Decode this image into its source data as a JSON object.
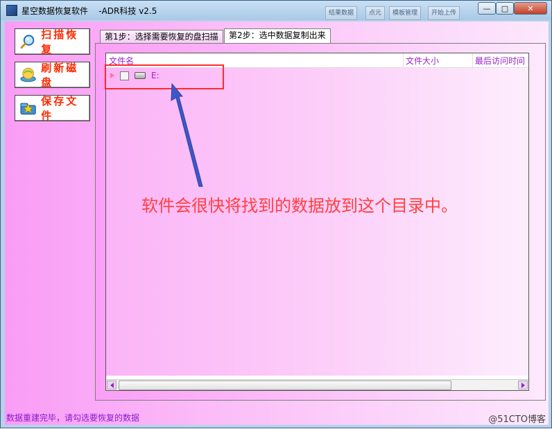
{
  "window": {
    "title": "星空数据恢复软件    -ADR科技 v2.5",
    "background_tabs": [
      "结果数据",
      "点元",
      "模板管理",
      "开始上传"
    ],
    "controls": {
      "minimize": "—",
      "maximize": "□",
      "close": "✕"
    }
  },
  "sidebar": {
    "buttons": [
      {
        "label": "扫描恢复",
        "icon": "magnifier-icon"
      },
      {
        "label": "刷新磁盘",
        "icon": "globe-disk-icon"
      },
      {
        "label": "保存文件",
        "icon": "save-folder-icon"
      }
    ]
  },
  "tabs": [
    {
      "label": "第1步：选择需要恢复的盘扫描",
      "active": false
    },
    {
      "label": "第2步：选中数据复制出来",
      "active": true
    }
  ],
  "file_list": {
    "columns": [
      "文件名",
      "文件大小",
      "最后访问时间"
    ],
    "rows": [
      {
        "name": "E:",
        "checked": false,
        "icon": "drive-icon"
      }
    ]
  },
  "annotation": {
    "text": "软件会很快将找到的数据放到这个目录中。",
    "color": "#ff4040"
  },
  "status": {
    "message": "数据重建完毕，请勾选要恢复的数据",
    "watermark": "@51CTO博客"
  },
  "colors": {
    "accent_text": "#a11fcf",
    "button_text": "#ff2a00",
    "highlight_border": "#ff2a2a",
    "panel_pink": "#fb9ff6"
  }
}
